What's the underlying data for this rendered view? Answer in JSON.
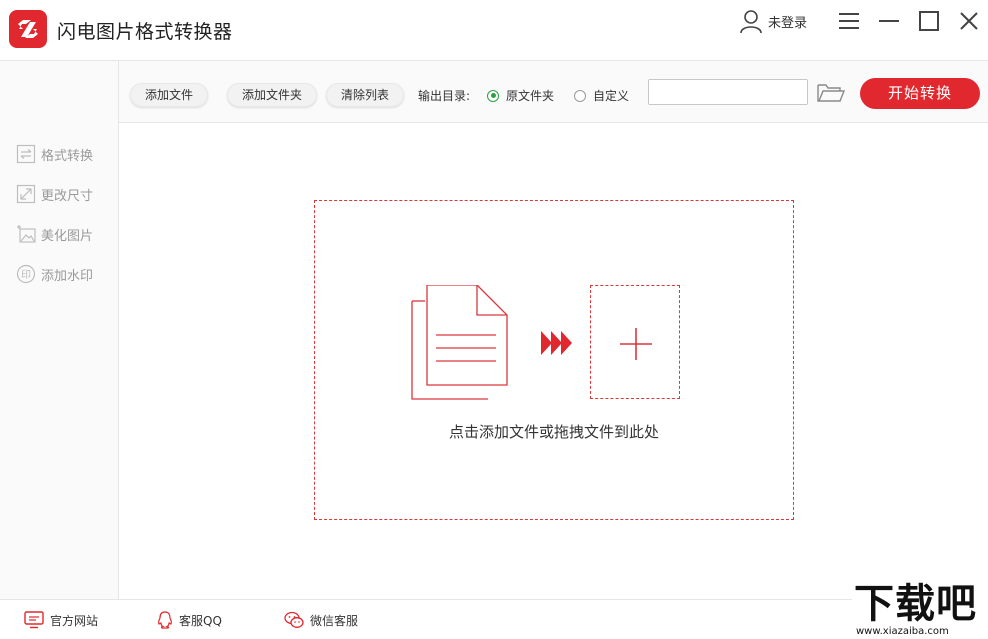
{
  "app": {
    "title": "闪电图片格式转换器",
    "user_label": "未登录",
    "accent_color": "#e0282e"
  },
  "window_controls": [
    "menu-icon",
    "minimize-icon",
    "maximize-icon",
    "close-icon"
  ],
  "sidebar": {
    "items": [
      {
        "label": "格式转换",
        "icon": "swap-icon"
      },
      {
        "label": "更改尺寸",
        "icon": "resize-icon"
      },
      {
        "label": "美化图片",
        "icon": "beautify-icon"
      },
      {
        "label": "添加水印",
        "icon": "seal-icon"
      }
    ]
  },
  "toolbar": {
    "add_file": "添加文件",
    "add_folder": "添加文件夹",
    "clear_list": "清除列表",
    "output_label": "输出目录:",
    "radio_original": "原文件夹",
    "radio_custom": "自定义",
    "selected_output": "原文件夹",
    "path_value": "",
    "start_button": "开始转换"
  },
  "main": {
    "drop_hint": "点击添加文件或拖拽文件到此处"
  },
  "footer": {
    "website": "官方网站",
    "qq": "客服QQ",
    "wechat": "微信客服"
  },
  "watermark": {
    "big": "下载吧",
    "small": "www.xiazaiba.com"
  }
}
